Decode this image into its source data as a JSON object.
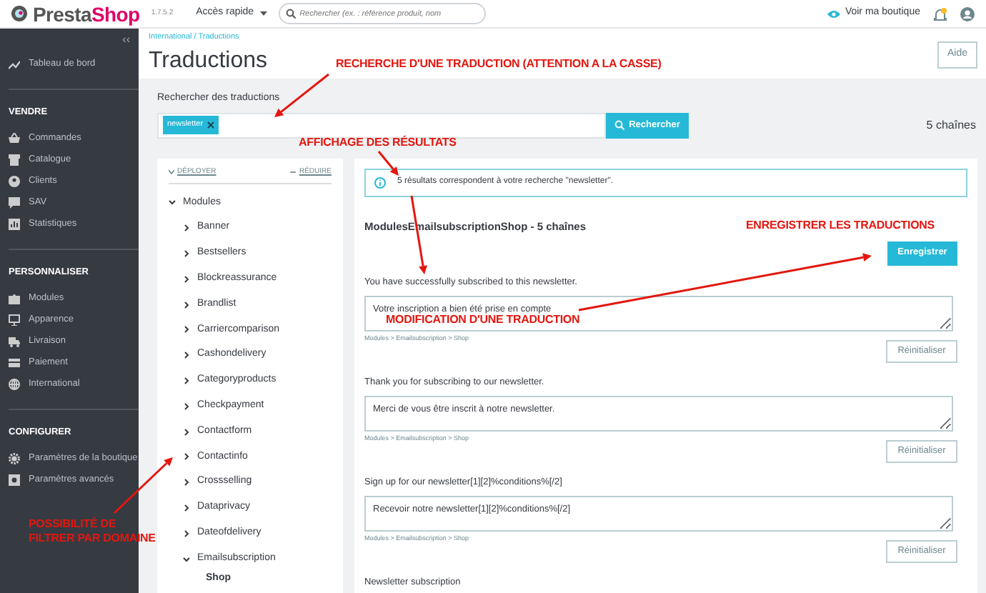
{
  "header": {
    "logo_parts": [
      "Presta",
      "Shop"
    ],
    "version": "1.7.5.2",
    "quick_access": "Accès rapide",
    "search": {
      "placeholder": "Rechercher (ex. : référence produit, nom"
    },
    "view_shop": "Voir ma boutique",
    "notification": true
  },
  "sidebar": {
    "collapse": "‹‹",
    "sections": [
      {
        "items": [
          "Tableau de bord"
        ]
      },
      {
        "title": "VENDRE",
        "items": [
          "Commandes",
          "Catalogue",
          "Clients",
          "SAV",
          "Statistiques"
        ]
      },
      {
        "title": "PERSONNALISER",
        "items": [
          "Modules",
          "Apparence",
          "Livraison",
          "Paiement",
          "International"
        ]
      },
      {
        "title": "CONFIGURER",
        "items": [
          "Paramètres de la boutique",
          "Paramètres avancés"
        ]
      }
    ]
  },
  "breadcrumb": "International / Traductions",
  "page_title": "Traductions",
  "help_button": "Aide",
  "search": {
    "label": "Rechercher des traductions",
    "tags": [
      "newsletter"
    ],
    "button": "Rechercher",
    "count": "5 chaînes"
  },
  "tree": {
    "expand_all": "DÉPLOYER",
    "collapse_all": "RÉDUIRE",
    "items": [
      {
        "label": "Modules",
        "expanded": true,
        "children": [
          {
            "label": "Banner",
            "expanded": false
          },
          {
            "label": "Bestsellers",
            "expanded": false
          },
          {
            "label": "Blockreassurance",
            "expanded": false
          },
          {
            "label": "Brandlist",
            "expanded": false
          },
          {
            "label": "Carriercomparison",
            "expanded": false
          },
          {
            "label": "Cashondelivery",
            "expanded": false
          },
          {
            "label": "Categoryproducts",
            "expanded": false
          },
          {
            "label": "Checkpayment",
            "expanded": false
          },
          {
            "label": "Contactform",
            "expanded": false
          },
          {
            "label": "Contactinfo",
            "expanded": false
          },
          {
            "label": "Crossselling",
            "expanded": false
          },
          {
            "label": "Dataprivacy",
            "expanded": false
          },
          {
            "label": "Dateofdelivery",
            "expanded": false
          },
          {
            "label": "Emailsubscription",
            "expanded": true,
            "children": [
              {
                "label": "Shop"
              }
            ]
          }
        ]
      }
    ]
  },
  "results": {
    "alert": "5 résultats correspondent à votre recherche \"newsletter\".",
    "heading": "ModulesEmailsubscriptionShop - 5 chaînes",
    "save_button": "Enregistrer",
    "entries": [
      {
        "source": "You have successfully subscribed to this newsletter.",
        "value": "Votre inscription a bien été prise en compte",
        "path": "Modules > Emailsubscription > Shop",
        "reset": "Réinitialiser"
      },
      {
        "source": "Thank you for subscribing to our newsletter.",
        "value": "Merci de vous être inscrit à notre newsletter.",
        "path": "Modules > Emailsubscription > Shop",
        "reset": "Réinitialiser"
      },
      {
        "source": "Sign up for our newsletter[1][2]%conditions%[/2]",
        "value": "Recevoir notre newsletter[1][2]%conditions%[/2]",
        "path": "Modules > Emailsubscription > Shop",
        "reset": "Réinitialiser"
      },
      {
        "source": "Newsletter subscription"
      }
    ]
  },
  "annotations": [
    {
      "text": "RECHERCHE D'UNE TRADUCTION (ATTENTION A LA CASSE)"
    },
    {
      "text": "AFFICHAGE DES RÉSULTATS"
    },
    {
      "text": "ENREGISTRER LES TRADUCTIONS"
    },
    {
      "text": "MODIFICATION D'UNE TRADUCTION"
    },
    {
      "text": "POSSIBILITÉ DE FILTRER PAR DOMAINE"
    }
  ]
}
